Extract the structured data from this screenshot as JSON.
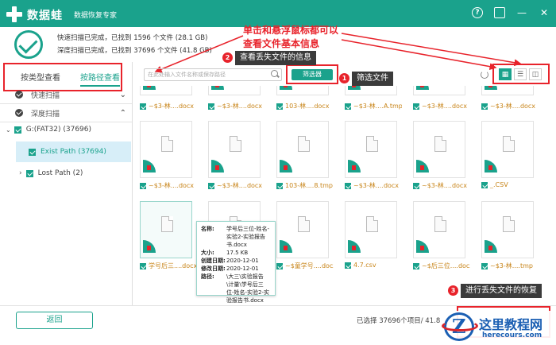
{
  "titlebar": {
    "app_name": "数据蛙",
    "app_sub": "数据恢复专家",
    "help_glyph": "?",
    "save_glyph": "💾",
    "minimize_glyph": "—",
    "close_glyph": "✕"
  },
  "scan": {
    "quick": "快速扫描已完成，已找到 1596 个文件 (28.1 GB)",
    "deep": "深度扫描已完成，已找到 37696 个文件 (41.8 GB)"
  },
  "annotations": {
    "main_line1": "单击和悬浮鼠标都可以",
    "main_line2": "查看文件基本信息",
    "tip2": "查看丢失文件的信息",
    "tip1": "筛选文件",
    "tip3": "进行丢失文件的恢复",
    "badge1": "1",
    "badge2": "2",
    "badge3": "3"
  },
  "left_panel": {
    "tab_type": "按类型查看",
    "tab_path": "按路径查看",
    "quick_scan": "快速扫描",
    "deep_scan": "深度扫描",
    "drive": "G:(FAT32) (37696)",
    "exist_path": "Exist Path (37694)",
    "lost_path": "Lost Path (2)"
  },
  "toolbar": {
    "search_placeholder": "在此处输入文件名称或保存路径",
    "filter_label": "筛选器",
    "view_grid": "▦",
    "view_list": "☰",
    "view_detail": "◫"
  },
  "grid": {
    "row1": [
      "~$3-林....docx",
      "~$3-林....docx",
      "103-林....docx",
      "~$3-林....A.tmp",
      "~$3-林....docx",
      "~$3-林....docx"
    ],
    "row2": [
      "~$3-林....docx",
      "~$3-林....docx",
      "103-林....8.tmp",
      "~$3-林....docx",
      "~$3-林....docx",
      "_.CSV"
    ],
    "row3": [
      "学号后三....docx",
      "~$3-林....docx",
      "~$童学号....docx",
      "4.7.csv",
      "~$后三位....docx",
      "~$3-林....tmp"
    ]
  },
  "info_popup": {
    "name_key": "名称:",
    "name_val": "学号后三位-姓名-实验2-实验报告书.docx",
    "size_key": "大小:",
    "size_val": "17.5 KB",
    "created_key": "创建日期:",
    "created_val": "2020-12-01",
    "modified_key": "修改日期:",
    "modified_val": "2020-12-01",
    "path_key": "路径:",
    "path_val": "\\大三\\实验报告\\计量\\学号后三位-姓名-实验2-实验报告书.docx"
  },
  "footer": {
    "back_label": "返回",
    "selected": "已选择 37696个项目/ 41.8"
  },
  "watermark": {
    "text": "这里教程网",
    "url": "herecours.com"
  },
  "colors": {
    "brand": "#1aa28c",
    "annotation": "#e8232b",
    "file_label": "#c8851a"
  }
}
